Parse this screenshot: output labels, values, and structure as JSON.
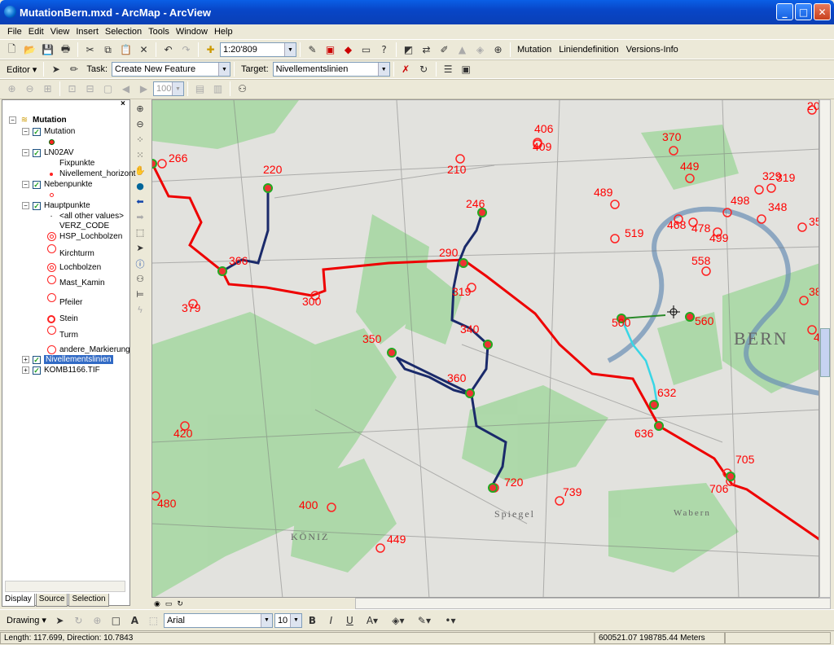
{
  "window": {
    "title": "MutationBern.mxd - ArcMap - ArcView",
    "minimize_glyph": "_",
    "maximize_glyph": "□",
    "close_glyph": "✕"
  },
  "menus": [
    "File",
    "Edit",
    "View",
    "Insert",
    "Selection",
    "Tools",
    "Window",
    "Help"
  ],
  "toolbar": {
    "scale": "1:20'809",
    "custom_menus": [
      "Mutation",
      "Liniendefinition",
      "Versions-Info"
    ],
    "zoom_percent": "100%"
  },
  "editor": {
    "label": "Editor",
    "task_label": "Task:",
    "task_value": "Create New Feature",
    "target_label": "Target:",
    "target_value": "Nivellementslinien"
  },
  "toc": {
    "close_glyph": "×",
    "root": "Mutation",
    "layers": [
      {
        "label": "Mutation",
        "level": 1
      },
      {
        "label": "LN02AV",
        "level": 1
      },
      {
        "label": "Fixpunkte",
        "level": 2
      },
      {
        "label": "Nivellement_horizont",
        "level": 2
      },
      {
        "label": "Nebenpunkte",
        "level": 1
      },
      {
        "label": "Hauptpunkte",
        "level": 1
      },
      {
        "label": "<all other values>",
        "level": 2
      },
      {
        "label": "VERZ_CODE",
        "level": 2
      },
      {
        "label": "HSP_Lochbolzen",
        "level": 2
      },
      {
        "label": "Kirchturm",
        "level": 2
      },
      {
        "label": "Lochbolzen",
        "level": 2
      },
      {
        "label": "Mast_Kamin",
        "level": 2
      },
      {
        "label": "Pfeiler",
        "level": 2
      },
      {
        "label": "Stein",
        "level": 2
      },
      {
        "label": "Turm",
        "level": 2
      },
      {
        "label": "andere_Markierung",
        "level": 2
      },
      {
        "label": "Nivellementslinien",
        "level": 1
      },
      {
        "label": "KOMB1166.TIF",
        "level": 1
      }
    ],
    "tabs": [
      "Display",
      "Source",
      "Selection"
    ]
  },
  "map": {
    "place_labels": [
      "BERN",
      "KÖNIZ",
      "Spiegel",
      "Wabern"
    ],
    "points": [
      {
        "label": "266"
      },
      {
        "label": "220"
      },
      {
        "label": "210"
      },
      {
        "label": "406"
      },
      {
        "label": "409"
      },
      {
        "label": "370"
      },
      {
        "label": "449"
      },
      {
        "label": "329"
      },
      {
        "label": "319"
      },
      {
        "label": "489"
      },
      {
        "label": "468"
      },
      {
        "label": "478"
      },
      {
        "label": "498"
      },
      {
        "label": "499"
      },
      {
        "label": "348"
      },
      {
        "label": "350"
      },
      {
        "label": "246"
      },
      {
        "label": "519"
      },
      {
        "label": "366"
      },
      {
        "label": "290"
      },
      {
        "label": "319"
      },
      {
        "label": "558"
      },
      {
        "label": "300"
      },
      {
        "label": "379"
      },
      {
        "label": "380"
      },
      {
        "label": "500"
      },
      {
        "label": "560"
      },
      {
        "label": "40"
      },
      {
        "label": "340"
      },
      {
        "label": "350"
      },
      {
        "label": "360"
      },
      {
        "label": "632"
      },
      {
        "label": "636"
      },
      {
        "label": "420"
      },
      {
        "label": "705"
      },
      {
        "label": "706"
      },
      {
        "label": "480"
      },
      {
        "label": "720"
      },
      {
        "label": "739"
      },
      {
        "label": "400"
      },
      {
        "label": "449"
      },
      {
        "label": "20"
      }
    ]
  },
  "drawing": {
    "label": "Drawing",
    "font": "Arial",
    "size": "10",
    "bold": "B",
    "italic": "I",
    "underline": "U",
    "text_tool": "A"
  },
  "status": {
    "length": "Length: 117.699, Direction: 10.7843",
    "coords": "600521.07  198785.44 Meters"
  }
}
